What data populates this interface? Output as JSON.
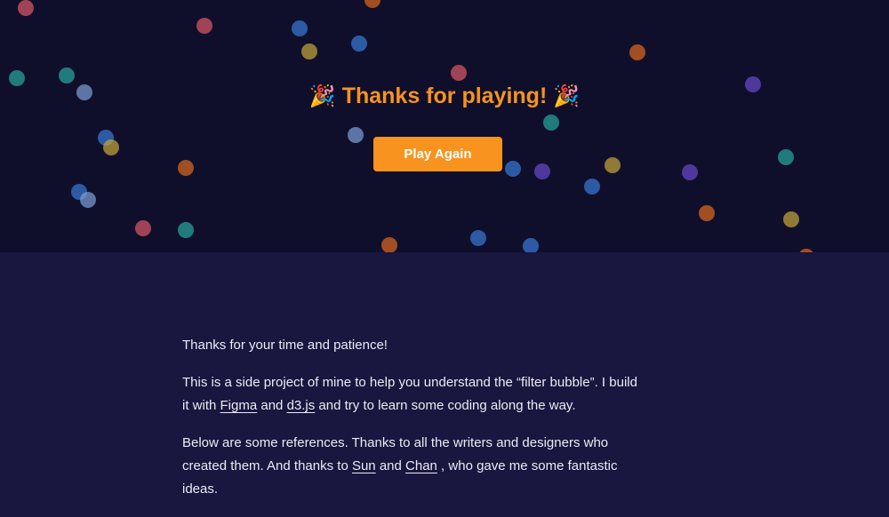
{
  "hero": {
    "title_emoji_left": "🎉",
    "title": "Thanks for playing!",
    "title_emoji_right": "🎉",
    "play_again_label": "Play Again"
  },
  "content": {
    "p1": "Thanks for your time and patience!",
    "p2_before": "This is a side project of mine to help you understand the “filter bubble”. I build it with ",
    "p2_link1": "Figma",
    "p2_mid": " and ",
    "p2_link2": "d3.js",
    "p2_after": " and try to learn some coding along the way.",
    "p3_before": "Below are some references. Thanks to all the writers and designers who created them. And thanks to ",
    "p3_link1": "Sun",
    "p3_mid": " and ",
    "p3_link2": "Chan",
    "p3_after": " , who gave me some fantastic ideas."
  },
  "colors": {
    "accent": "#f7931e",
    "hero_bg": "#100f2b",
    "page_bg": "#19163f",
    "confetti": [
      "#e05a6a",
      "#2aa9a0",
      "#3a7ad8",
      "#e06a1e",
      "#c8a83a",
      "#6a4ad0",
      "#7fa0d8"
    ]
  }
}
